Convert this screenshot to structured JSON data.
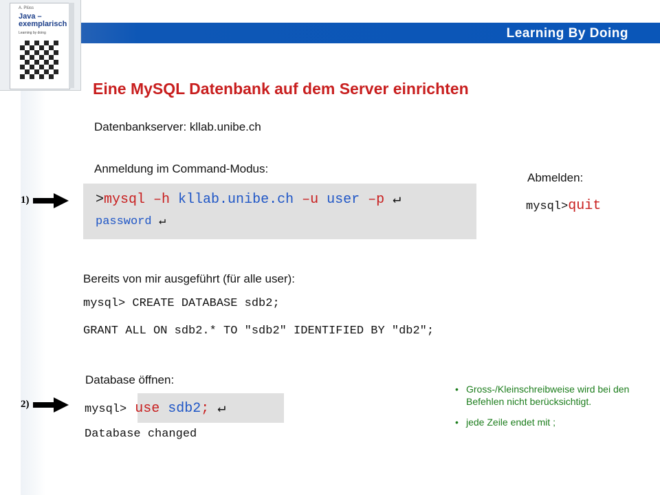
{
  "header": {
    "title": "Learning By Doing"
  },
  "book": {
    "author": "A. Plüss",
    "title_line1": "Java –",
    "title_line2": "exemplarisch",
    "subtitle": "Learning by doing"
  },
  "slide_title": "Eine MySQL Datenbank auf dem Server einrichten",
  "server_label": "Datenbankserver: kllab.unibe.ch",
  "login_label": "Anmeldung im Command-Modus:",
  "login_box": {
    "prompt": ">",
    "command_mysql": "mysql",
    "command_h": " –h ",
    "command_host": "kllab.unibe.ch",
    "command_u": " –u ",
    "command_user": "user",
    "command_p": " –p ",
    "enter_symbol": "↵",
    "password": "password",
    "enter_symbol_2": "↵"
  },
  "logout": {
    "label": "Abmelden:",
    "prompt": "mysql>",
    "command": "quit"
  },
  "step1_label": "1)",
  "step2_label": "2)",
  "done_label": "Bereits von mir ausgeführt (für alle user):",
  "create_db_line": "mysql> CREATE DATABASE sdb2;",
  "grant_line": "GRANT ALL ON sdb2.* TO \"sdb2\" IDENTIFIED BY \"db2\";",
  "open_label": "Database öffnen:",
  "use_box": {
    "prompt": "mysql>",
    "command_use": " use ",
    "command_db": "sdb2",
    "semicolon": ";",
    "enter_symbol": "↵"
  },
  "changed_line": "Database changed",
  "notes": [
    "Gross-/Kleinschreibweise wird bei den Befehlen nicht berücksichtigt.",
    "jede Zeile endet mit ;"
  ],
  "colors": {
    "header_blue": "#0a56b8",
    "title_red": "#c81e1e",
    "command_red": "#c81e1e",
    "command_blue": "#1f56c6",
    "note_green": "#1c7d1c",
    "box_gray": "#e0e0e0"
  }
}
